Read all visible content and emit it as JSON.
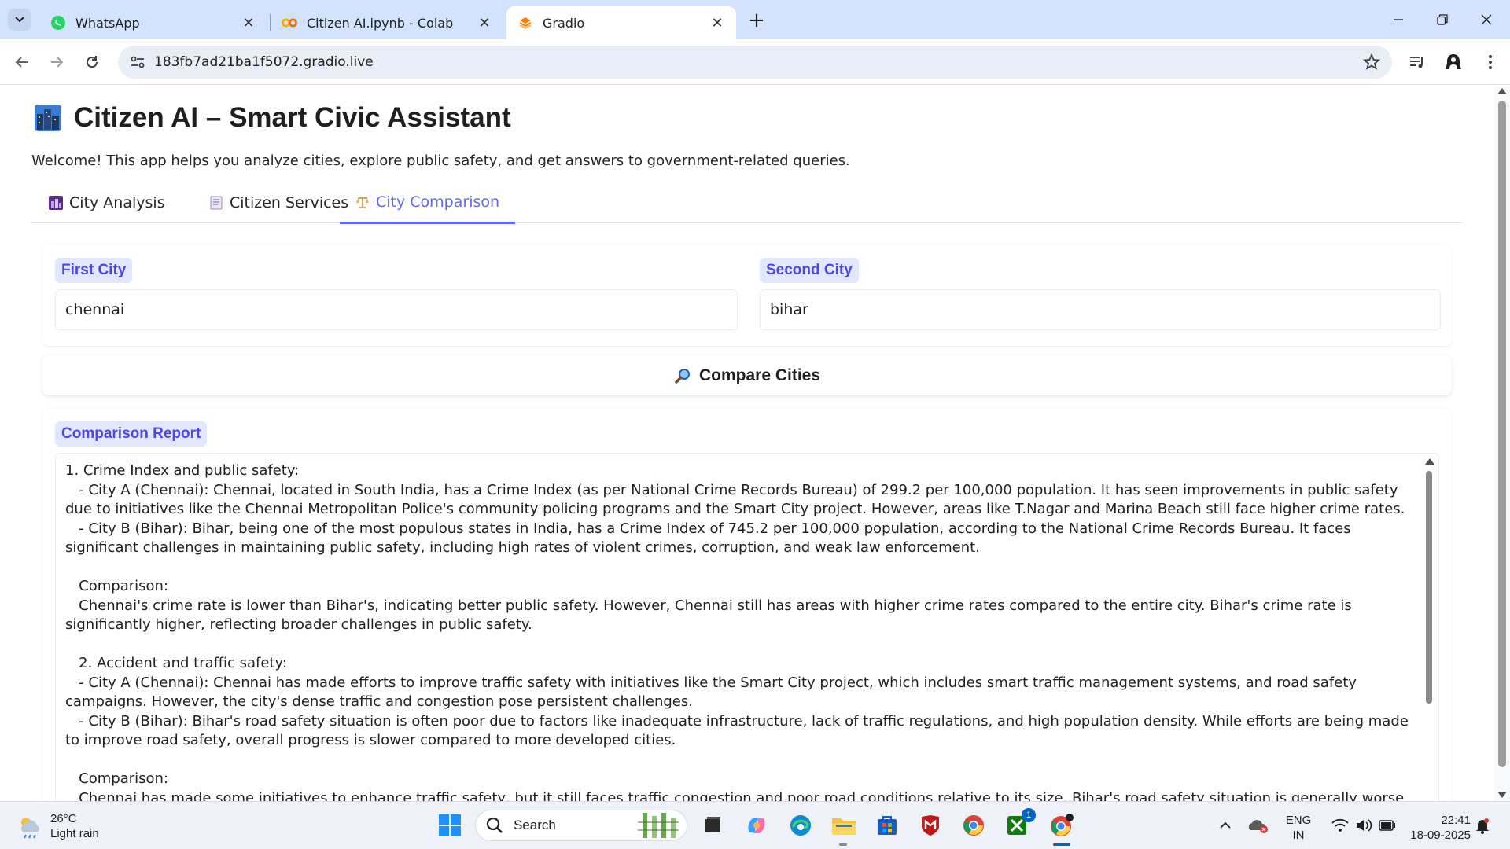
{
  "browser": {
    "tabs": [
      {
        "title": "WhatsApp",
        "icon": "whatsapp-icon"
      },
      {
        "title": "Citizen AI.ipynb - Colab",
        "icon": "colab-icon"
      },
      {
        "title": "Gradio",
        "icon": "gradio-icon",
        "active": true
      }
    ],
    "url": "183fb7ad21ba1f5072.gradio.live"
  },
  "app": {
    "title": "Citizen AI – Smart Civic Assistant",
    "welcome": "Welcome! This app helps you analyze cities, explore public safety, and get answers to government-related queries.",
    "tabs": [
      {
        "label": "City Analysis",
        "icon": "city-icon"
      },
      {
        "label": "Citizen Services",
        "icon": "document-icon"
      },
      {
        "label": "City Comparison",
        "icon": "scales-icon",
        "active": true
      }
    ],
    "first_city": {
      "label": "First City",
      "value": "chennai"
    },
    "second_city": {
      "label": "Second City",
      "value": "bihar"
    },
    "compare_button": "Compare Cities",
    "report": {
      "label": "Comparison Report",
      "text": "1. Crime Index and public safety:\n   - City A (Chennai): Chennai, located in South India, has a Crime Index (as per National Crime Records Bureau) of 299.2 per 100,000 population. It has seen improvements in public safety due to initiatives like the Chennai Metropolitan Police's community policing programs and the Smart City project. However, areas like T.Nagar and Marina Beach still face higher crime rates.\n   - City B (Bihar): Bihar, being one of the most populous states in India, has a Crime Index of 745.2 per 100,000 population, according to the National Crime Records Bureau. It faces significant challenges in maintaining public safety, including high rates of violent crimes, corruption, and weak law enforcement.\n\n   Comparison:\n   Chennai's crime rate is lower than Bihar's, indicating better public safety. However, Chennai still has areas with higher crime rates compared to the entire city. Bihar's crime rate is significantly higher, reflecting broader challenges in public safety.\n\n   2. Accident and traffic safety:\n   - City A (Chennai): Chennai has made efforts to improve traffic safety with initiatives like the Smart City project, which includes smart traffic management systems, and road safety campaigns. However, the city's dense traffic and congestion pose persistent challenges.\n   - City B (Bihar): Bihar's road safety situation is often poor due to factors like inadequate infrastructure, lack of traffic regulations, and high population density. While efforts are being made to improve road safety, overall progress is slower compared to more developed cities.\n\n   Comparison:\n   Chennai has made some initiatives to enhance traffic safety, but it still faces traffic congestion and poor road conditions relative to its size. Bihar's road safety situation is generally worse due"
    }
  },
  "taskbar": {
    "weather_temp": "26°C",
    "weather_desc": "Light rain",
    "search_label": "Search",
    "badge_count": "1",
    "lang_line1": "ENG",
    "lang_line2": "IN",
    "time": "22:41",
    "date": "18-09-2025"
  }
}
